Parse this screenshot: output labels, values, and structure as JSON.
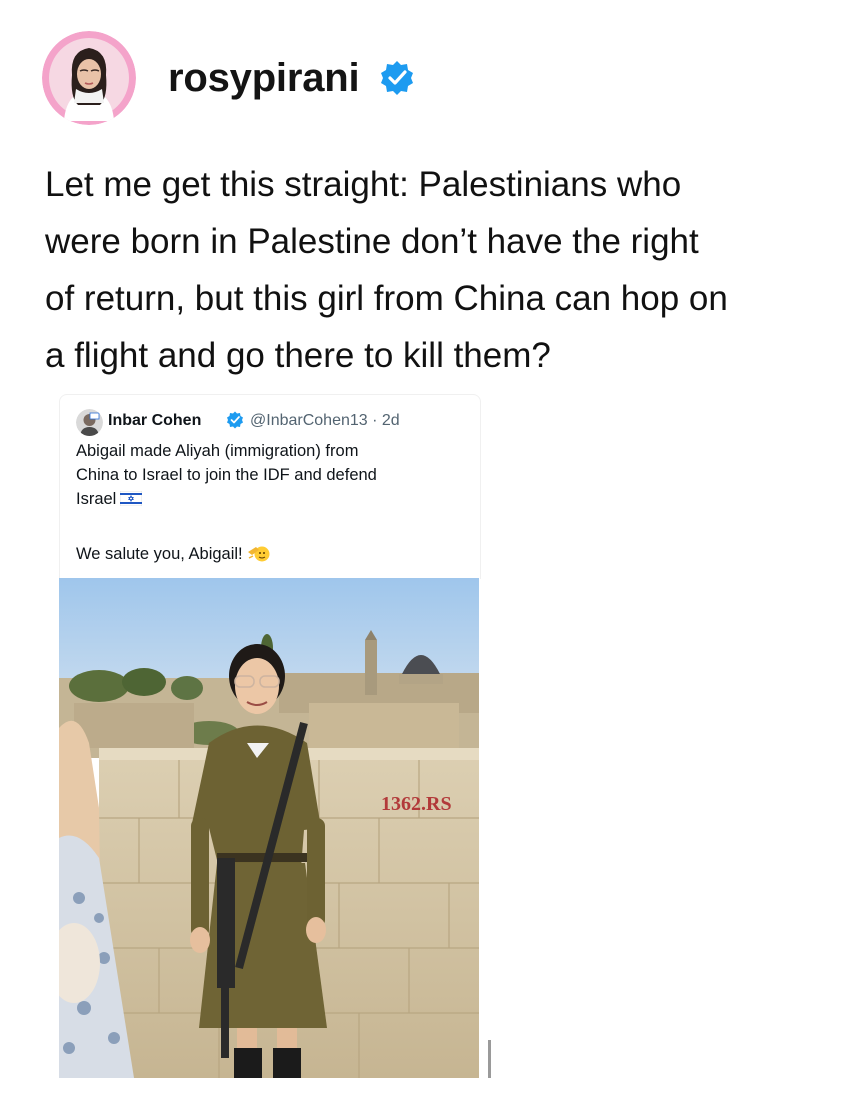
{
  "post": {
    "username": "rosypirani",
    "verified_icon": "verified-badge-icon",
    "text_lines": [
      "Let me get this straight: Palestinians who",
      "were born in Palestine don’t have the right",
      "of return, but this girl from China can hop on",
      "a flight and go there to kill them?"
    ]
  },
  "embedded_tweet": {
    "name": "Inbar Cohen",
    "handle_time": "@InbarCohen13 · 2d",
    "body_lines": [
      "Abigail made Aliyah (immigration) from",
      "China to Israel to join the IDF and defend",
      "Israel"
    ],
    "salute_line": "We salute you, Abigail!",
    "photo": {
      "wall_marking": "1362.RS"
    }
  },
  "colors": {
    "verified_blue": "#1d9bf0",
    "avatar_pink": "#f2a8cc",
    "handle_gray": "#536471"
  }
}
